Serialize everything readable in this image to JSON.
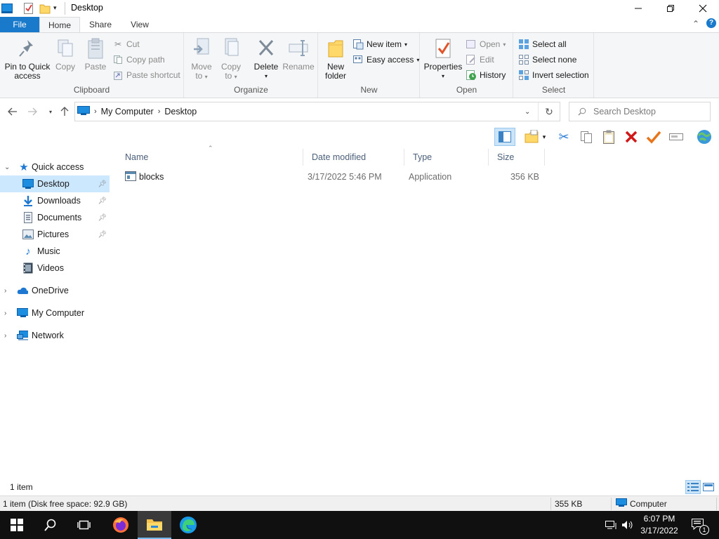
{
  "window": {
    "title": "Desktop",
    "accent": "#1979ca"
  },
  "tabs": [
    {
      "label": "File"
    },
    {
      "label": "Home"
    },
    {
      "label": "Share"
    },
    {
      "label": "View"
    }
  ],
  "ribbon": {
    "clipboard": {
      "label": "Clipboard",
      "pin": "Pin to Quick access",
      "pin_line1": "Pin to Quick",
      "pin_line2": "access",
      "copy": "Copy",
      "paste": "Paste",
      "cut": "Cut",
      "copy_path": "Copy path",
      "paste_shortcut": "Paste shortcut"
    },
    "organize": {
      "label": "Organize",
      "move_to_1": "Move",
      "move_to_2": "to",
      "copy_to_1": "Copy",
      "copy_to_2": "to",
      "delete": "Delete",
      "rename": "Rename"
    },
    "new": {
      "label": "New",
      "new_folder_1": "New",
      "new_folder_2": "folder",
      "new_item": "New item",
      "easy_access": "Easy access"
    },
    "open": {
      "label": "Open",
      "properties": "Properties",
      "open": "Open",
      "edit": "Edit",
      "history": "History"
    },
    "select": {
      "label": "Select",
      "select_all": "Select all",
      "select_none": "Select none",
      "invert": "Invert selection"
    }
  },
  "address": {
    "crumbs": [
      "My Computer",
      "Desktop"
    ],
    "search_placeholder": "Search Desktop"
  },
  "nav": {
    "quick_access": "Quick access",
    "items": [
      {
        "label": "Desktop",
        "icon": "desktop-icon",
        "pinned": true,
        "selected": true
      },
      {
        "label": "Downloads",
        "icon": "download-icon",
        "pinned": true
      },
      {
        "label": "Documents",
        "icon": "document-icon",
        "pinned": true
      },
      {
        "label": "Pictures",
        "icon": "pictures-icon",
        "pinned": true
      },
      {
        "label": "Music",
        "icon": "music-icon",
        "pinned": false
      },
      {
        "label": "Videos",
        "icon": "video-icon",
        "pinned": false
      }
    ],
    "onedrive": "OneDrive",
    "my_computer": "My Computer",
    "network": "Network"
  },
  "filelist": {
    "columns": [
      "Name",
      "Date modified",
      "Type",
      "Size"
    ],
    "rows": [
      {
        "name": "blocks",
        "date": "3/17/2022 5:46 PM",
        "type": "Application",
        "size": "356 KB"
      }
    ]
  },
  "status": {
    "item_count": "1 item",
    "disk_info": "1 item (Disk free space: 92.9 GB)",
    "size": "355 KB",
    "location": "Computer"
  },
  "taskbar": {
    "time": "6:07 PM",
    "date": "3/17/2022",
    "notification_count": "1"
  }
}
